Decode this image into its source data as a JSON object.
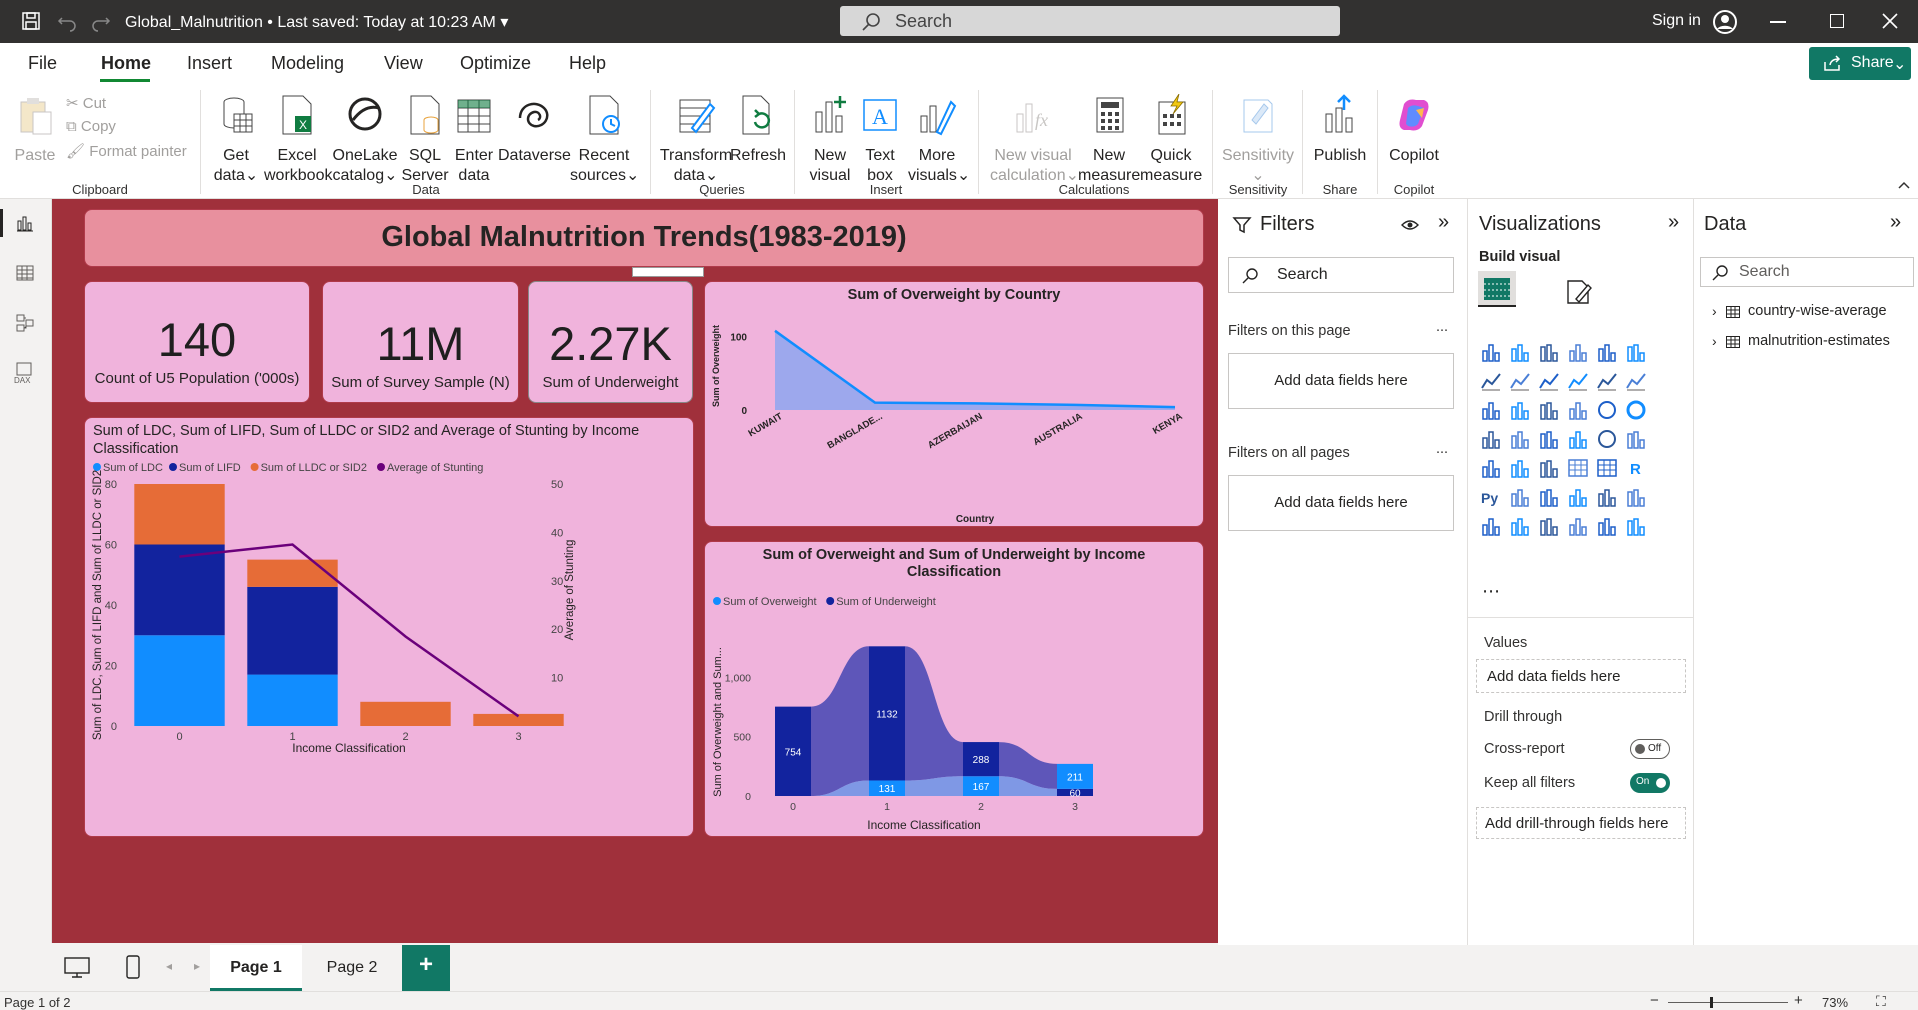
{
  "window": {
    "doc_title": "Global_Malnutrition",
    "saved_status": "Last saved: Today at 10:23 AM",
    "search_placeholder": "Search",
    "signin": "Sign in"
  },
  "menu": {
    "file": "File",
    "home": "Home",
    "insert": "Insert",
    "modeling": "Modeling",
    "view": "View",
    "optimize": "Optimize",
    "help": "Help",
    "share": "Share"
  },
  "ribbon": {
    "clipboard": {
      "paste": "Paste",
      "cut": "Cut",
      "copy": "Copy",
      "format_painter": "Format painter",
      "label": "Clipboard"
    },
    "data": {
      "get_data_1": "Get",
      "get_data_2": "data",
      "excel_1": "Excel",
      "excel_2": "workbook",
      "onelake_1": "OneLake",
      "onelake_2": "catalog",
      "sql_1": "SQL",
      "sql_2": "Server",
      "enter_1": "Enter",
      "enter_2": "data",
      "dataverse": "Dataverse",
      "recent_1": "Recent",
      "recent_2": "sources",
      "label": "Data"
    },
    "queries": {
      "transform_1": "Transform",
      "transform_2": "data",
      "refresh": "Refresh",
      "label": "Queries"
    },
    "insert": {
      "new_visual_1": "New",
      "new_visual_2": "visual",
      "text_box_1": "Text",
      "text_box_2": "box",
      "more_visuals_1": "More",
      "more_visuals_2": "visuals",
      "label": "Insert"
    },
    "calculations": {
      "new_calc_1": "New visual",
      "new_calc_2": "calculation",
      "new_measure_1": "New",
      "new_measure_2": "measure",
      "quick_measure_1": "Quick",
      "quick_measure_2": "measure",
      "label": "Calculations"
    },
    "sensitivity": {
      "sensitivity": "Sensitivity",
      "label": "Sensitivity"
    },
    "share": {
      "publish": "Publish",
      "label": "Share"
    },
    "copilot": {
      "copilot": "Copilot",
      "label": "Copilot"
    }
  },
  "report": {
    "title": "Global Malnutrition Trends(1983-2019)",
    "kpis": [
      {
        "value": "140",
        "label": "Count of U5 Population ('000s)"
      },
      {
        "value": "11M",
        "label": "Sum of Survey Sample (N)"
      },
      {
        "value": "2.27K",
        "label": "Sum of Underweight"
      }
    ]
  },
  "colors": {
    "ldc": "#118dff",
    "lifd": "#12239e",
    "lldc": "#e66c37",
    "stunting": "#6b007b",
    "overweight": "#118dff",
    "underweight": "#12239e",
    "canvas": "#a0303b",
    "card": "#f0b3dc"
  },
  "chart_data": [
    {
      "type": "bar",
      "title": "Sum of LDC, Sum of LIFD, Sum of LLDC or SID2 and Average of Stunting by Income Classification",
      "xlabel": "Income Classification",
      "ylabel": "Sum of LDC, Sum of LIFD and Sum of LLDC or SID2",
      "y2label": "Average of Stunting",
      "categories": [
        "0",
        "1",
        "2",
        "3"
      ],
      "ylim": [
        0,
        80
      ],
      "y2lim": [
        0,
        50
      ],
      "yticks": [
        "0",
        "20",
        "40",
        "60",
        "80"
      ],
      "y2ticks": [
        "10",
        "20",
        "30",
        "40",
        "50"
      ],
      "stacked": true,
      "legend_position": "top-left",
      "series": [
        {
          "name": "Sum of LDC",
          "values": [
            30,
            17,
            0,
            0
          ]
        },
        {
          "name": "Sum of LIFD",
          "values": [
            30,
            29,
            0,
            0
          ]
        },
        {
          "name": "Sum of LLDC or SID2",
          "values": [
            20,
            9,
            8,
            4
          ]
        },
        {
          "name": "Average of Stunting",
          "kind": "line",
          "values": [
            35,
            37.5,
            18.5,
            2
          ]
        }
      ]
    },
    {
      "type": "area",
      "title": "Sum of Overweight by Country",
      "xlabel": "Country",
      "ylabel": "Sum of Overweight",
      "categories": [
        "KUWAIT",
        "BANGLADE...",
        "AZERBAIJAN",
        "AUSTRALIA",
        "KENYA"
      ],
      "yticks": [
        "0",
        "100"
      ],
      "ylim": [
        0,
        120
      ],
      "series": [
        {
          "name": "Sum of Overweight",
          "values": [
            108,
            10,
            9,
            7,
            4
          ]
        }
      ]
    },
    {
      "type": "bar",
      "subtype": "ribbon",
      "title": "Sum of Overweight and Sum of Underweight by Income Classification",
      "xlabel": "Income Classification",
      "ylabel": "Sum of Overweight and Sum...",
      "categories": [
        "0",
        "1",
        "2",
        "3"
      ],
      "yticks": [
        "0",
        "500",
        "1,000"
      ],
      "ylim": [
        0,
        1350
      ],
      "legend_position": "top-left",
      "series": [
        {
          "name": "Sum of Overweight",
          "values": [
            0,
            131,
            167,
            211
          ]
        },
        {
          "name": "Sum of Underweight",
          "values": [
            754,
            1132,
            288,
            60
          ]
        }
      ]
    }
  ],
  "filters": {
    "title": "Filters",
    "search": "Search",
    "on_page": "Filters on this page",
    "on_all": "Filters on all pages",
    "add": "Add data fields here",
    "more": "..."
  },
  "viz": {
    "title": "Visualizations",
    "build": "Build visual",
    "values": "Values",
    "add_values": "Add data fields here",
    "drill": "Drill through",
    "cross": "Cross-report",
    "cross_state": "Off",
    "keep": "Keep all filters",
    "keep_state": "On",
    "add_drill": "Add drill-through fields here"
  },
  "data_pane": {
    "title": "Data",
    "search": "Search",
    "tables": [
      "country-wise-average",
      "malnutrition-estimates"
    ]
  },
  "pages": {
    "page1": "Page 1",
    "page2": "Page 2",
    "add": "+"
  },
  "status": {
    "page": "Page 1 of 2",
    "zoom": "73%"
  }
}
